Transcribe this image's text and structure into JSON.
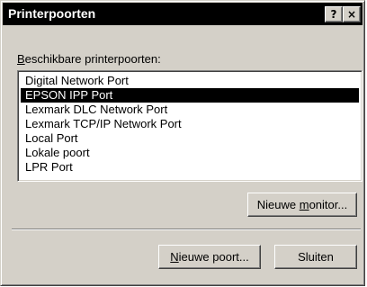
{
  "window": {
    "title": "Printerpoorten",
    "help_button": "?",
    "close_button": "×"
  },
  "ports_label": {
    "mnemonic": "B",
    "rest": "eschikbare printerpoorten:"
  },
  "ports_list": {
    "items": [
      "Digital Network Port",
      "EPSON IPP Port",
      "Lexmark DLC Network Port",
      "Lexmark TCP/IP Network Port",
      "Local Port",
      "Lokale poort",
      "LPR Port"
    ],
    "selected_index": 1
  },
  "buttons": {
    "new_monitor": {
      "before": "Nieuwe ",
      "mnemonic": "m",
      "after": "onitor..."
    },
    "new_port": {
      "before": "",
      "mnemonic": "N",
      "after": "ieuwe poort..."
    },
    "close": "Sluiten"
  },
  "colors": {
    "dialog_face": "#d4d0c8",
    "titlebar": "#000000",
    "selection": "#000000",
    "list_background": "#ffffff"
  }
}
